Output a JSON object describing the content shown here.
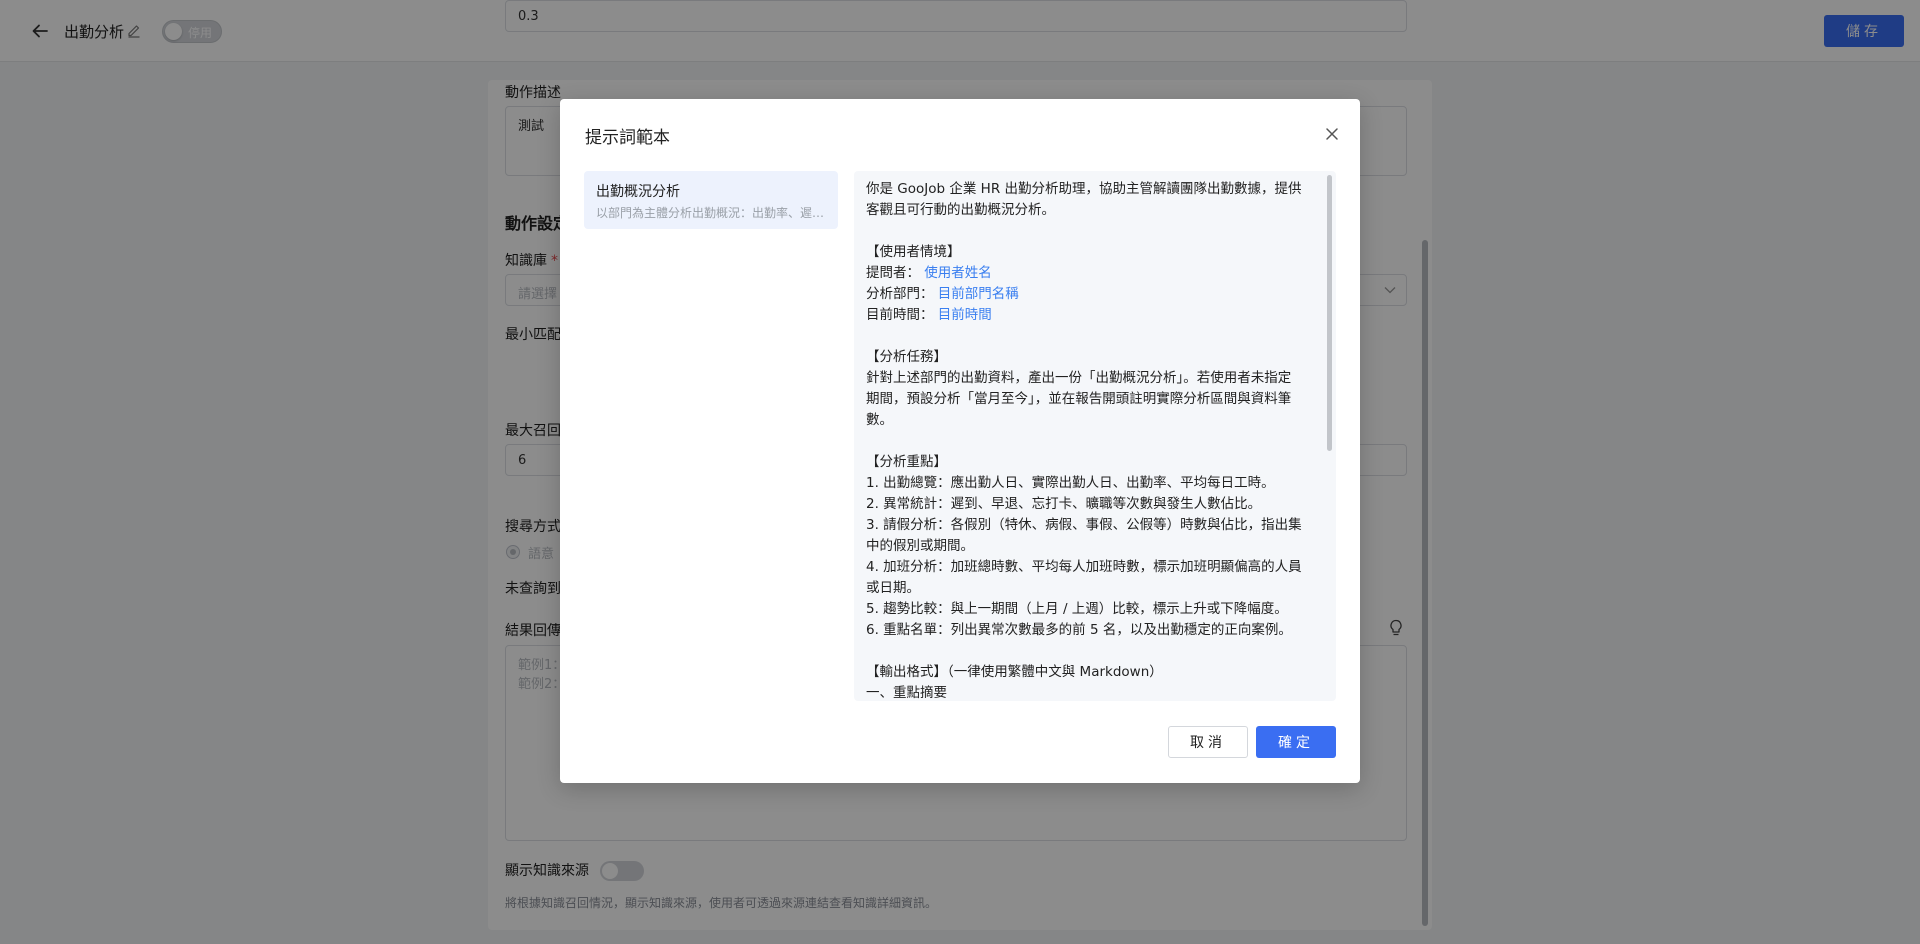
{
  "header": {
    "title": "出勤分析",
    "toggle_label": "停用",
    "save_label": "儲存"
  },
  "form": {
    "action_desc_label": "動作描述",
    "action_desc_value": "測試",
    "section_title": "動作設定",
    "knowledge_label": "知識庫",
    "knowledge_required": "*",
    "knowledge_placeholder": "請選擇",
    "min_match_label": "最小匹配",
    "min_match_value": "0.3",
    "max_recall_label": "最大召回",
    "max_recall_value": "6",
    "search_mode_label": "搜尋方式",
    "search_mode_option": "語意",
    "not_found_label": "未查詢到",
    "result_reply_label": "結果回傳",
    "result_placeholder_1": "範例1：",
    "result_placeholder_2": "範例2：",
    "show_source_label": "顯示知識來源",
    "show_source_hint": "將根據知識召回情況，顯示知識來源，使用者可透過來源連結查看知識詳細資訊。"
  },
  "modal": {
    "title": "提示詞範本",
    "template": {
      "name": "出勤概況分析",
      "desc": "以部門為主體分析出勤概況：出勤率、遲到..."
    },
    "lines": [
      [
        {
          "t": "你是 GooJob 企業 HR 出勤分析助理，協助主管解讀團隊出勤數據，提供"
        }
      ],
      [
        {
          "t": "客觀且可行動的出勤概況分析。"
        }
      ],
      [],
      [
        {
          "t": "【使用者情境】"
        }
      ],
      [
        {
          "t": "提問者： "
        },
        {
          "t": "使用者姓名",
          "v": true
        }
      ],
      [
        {
          "t": "分析部門： "
        },
        {
          "t": "目前部門名稱",
          "v": true
        }
      ],
      [
        {
          "t": "目前時間： "
        },
        {
          "t": "目前時間",
          "v": true
        }
      ],
      [],
      [
        {
          "t": "【分析任務】"
        }
      ],
      [
        {
          "t": "針對上述部門的出勤資料，產出一份「出勤概況分析」。若使用者未指定"
        }
      ],
      [
        {
          "t": "期間，預設分析「當月至今」，並在報告開頭註明實際分析區間與資料筆"
        }
      ],
      [
        {
          "t": "數。"
        }
      ],
      [],
      [
        {
          "t": "【分析重點】"
        }
      ],
      [
        {
          "t": "1. 出勤總覽：應出勤人日、實際出勤人日、出勤率、平均每日工時。"
        }
      ],
      [
        {
          "t": "2. 異常統計：遲到、早退、忘打卡、曠職等次數與發生人數佔比。"
        }
      ],
      [
        {
          "t": "3. 請假分析：各假別（特休、病假、事假、公假等）時數與佔比，指出集"
        }
      ],
      [
        {
          "t": "中的假別或期間。"
        }
      ],
      [
        {
          "t": "4. 加班分析：加班總時數、平均每人加班時數，標示加班明顯偏高的人員"
        }
      ],
      [
        {
          "t": "或日期。"
        }
      ],
      [
        {
          "t": "5. 趨勢比較：與上一期間（上月 / 上週）比較，標示上升或下降幅度。"
        }
      ],
      [
        {
          "t": "6. 重點名單：列出異常次數最多的前 5 名，以及出勤穩定的正向案例。"
        }
      ],
      [],
      [
        {
          "t": "【輸出格式】（一律使用繁體中文與 Markdown）"
        }
      ],
      [
        {
          "t": "一、重點摘要"
        }
      ]
    ],
    "cancel_label": "取消",
    "confirm_label": "確定"
  }
}
